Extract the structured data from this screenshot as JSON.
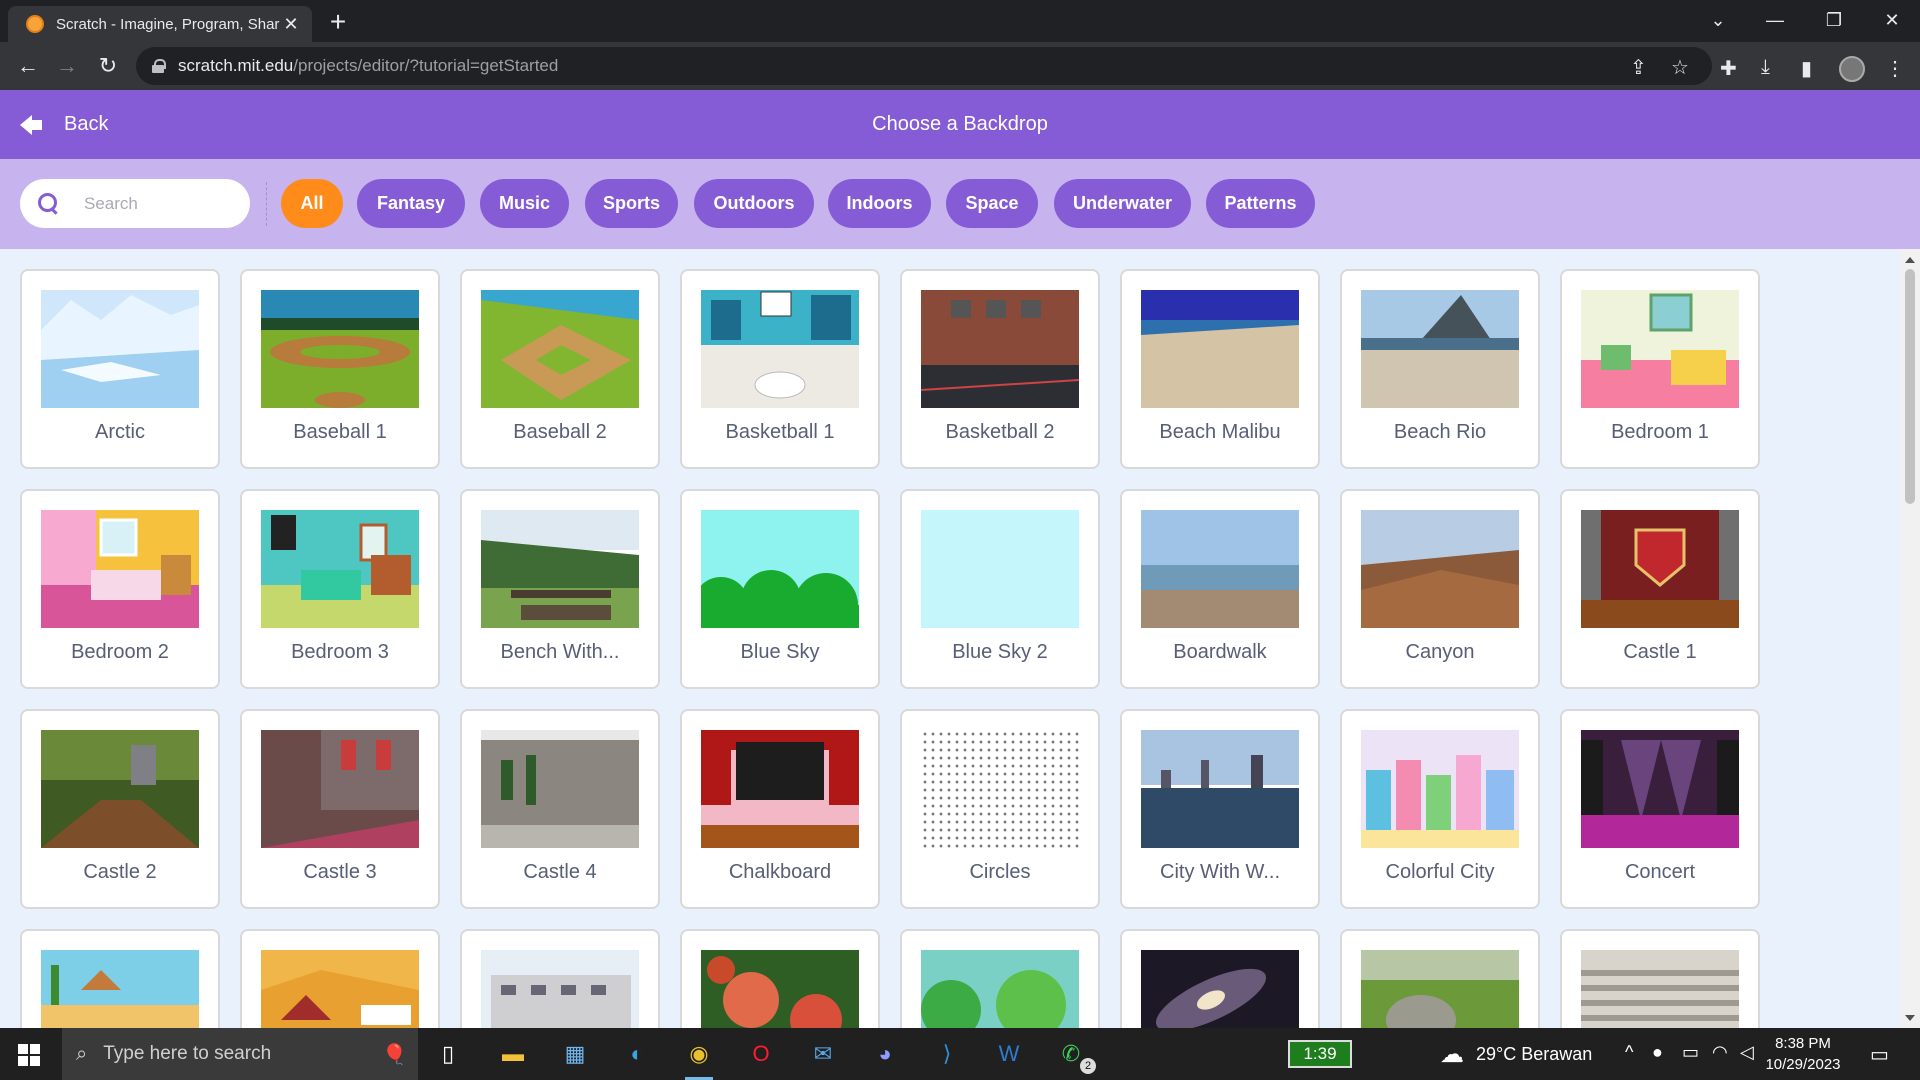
{
  "browser": {
    "tab_title": "Scratch - Imagine, Program, Share",
    "url_host": "scratch.mit.edu",
    "url_path": "/projects/editor/?tutorial=getStarted"
  },
  "header": {
    "back_label": "Back",
    "title": "Choose a Backdrop"
  },
  "filter": {
    "search_placeholder": "Search",
    "tags": [
      "All",
      "Fantasy",
      "Music",
      "Sports",
      "Outdoors",
      "Indoors",
      "Space",
      "Underwater",
      "Patterns"
    ],
    "active_tag": "All"
  },
  "backdrops": [
    {
      "name": "Arctic"
    },
    {
      "name": "Baseball 1"
    },
    {
      "name": "Baseball 2"
    },
    {
      "name": "Basketball 1"
    },
    {
      "name": "Basketball 2"
    },
    {
      "name": "Beach Malibu"
    },
    {
      "name": "Beach Rio"
    },
    {
      "name": "Bedroom 1"
    },
    {
      "name": "Bedroom 2"
    },
    {
      "name": "Bedroom 3"
    },
    {
      "name": "Bench With..."
    },
    {
      "name": "Blue Sky"
    },
    {
      "name": "Blue Sky 2"
    },
    {
      "name": "Boardwalk"
    },
    {
      "name": "Canyon"
    },
    {
      "name": "Castle 1"
    },
    {
      "name": "Castle 2"
    },
    {
      "name": "Castle 3"
    },
    {
      "name": "Castle 4"
    },
    {
      "name": "Chalkboard"
    },
    {
      "name": "Circles"
    },
    {
      "name": "City With W..."
    },
    {
      "name": "Colorful City"
    },
    {
      "name": "Concert"
    },
    {
      "name": ""
    },
    {
      "name": ""
    },
    {
      "name": ""
    },
    {
      "name": ""
    },
    {
      "name": ""
    },
    {
      "name": ""
    },
    {
      "name": ""
    },
    {
      "name": ""
    }
  ],
  "taskbar": {
    "search_placeholder": "Type here to search",
    "battery_widget": "1:39",
    "whatsapp_badge": "2",
    "weather": "29°C Berawan",
    "time": "8:38 PM",
    "date": "10/29/2023"
  },
  "colors": {
    "scratch_purple": "#855cd6",
    "filter_bg": "#c7b3ed",
    "active_tag": "#ff8c1a",
    "grid_bg": "#e9f1fc"
  }
}
